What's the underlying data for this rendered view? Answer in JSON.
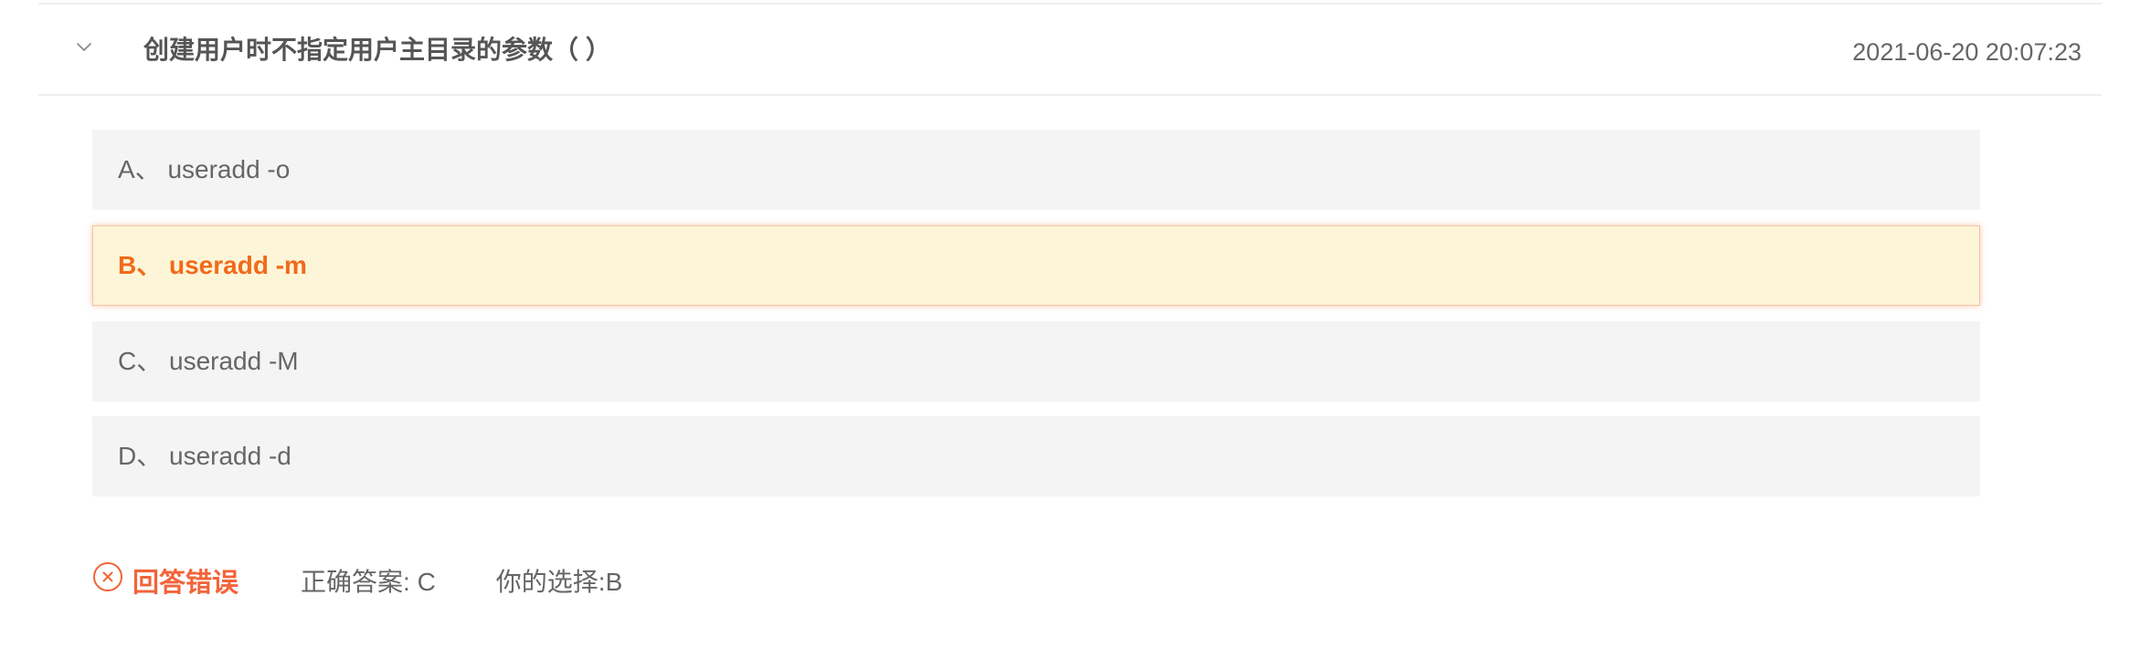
{
  "question": {
    "title": "创建用户时不指定用户主目录的参数（ ）",
    "timestamp": "2021-06-20 20:07:23",
    "toggle_icon": "chevron-down-icon"
  },
  "options": [
    {
      "letter": "A",
      "label": "A、 useradd -o",
      "selected": false
    },
    {
      "letter": "B",
      "label": "B、 useradd -m",
      "selected": true
    },
    {
      "letter": "C",
      "label": "C、 useradd -M",
      "selected": false
    },
    {
      "letter": "D",
      "label": "D、 useradd -d",
      "selected": false
    }
  ],
  "result": {
    "status_icon": "close-circle-icon",
    "status_label": "回答错误",
    "correct_answer": "正确答案: C",
    "your_choice": "你的选择:B"
  },
  "colors": {
    "wrong": "#f2643a",
    "selected_text": "#f26a1b",
    "selected_bg": "#fdf5d8",
    "option_bg": "#f4f4f4",
    "divider": "#eeeeee"
  }
}
